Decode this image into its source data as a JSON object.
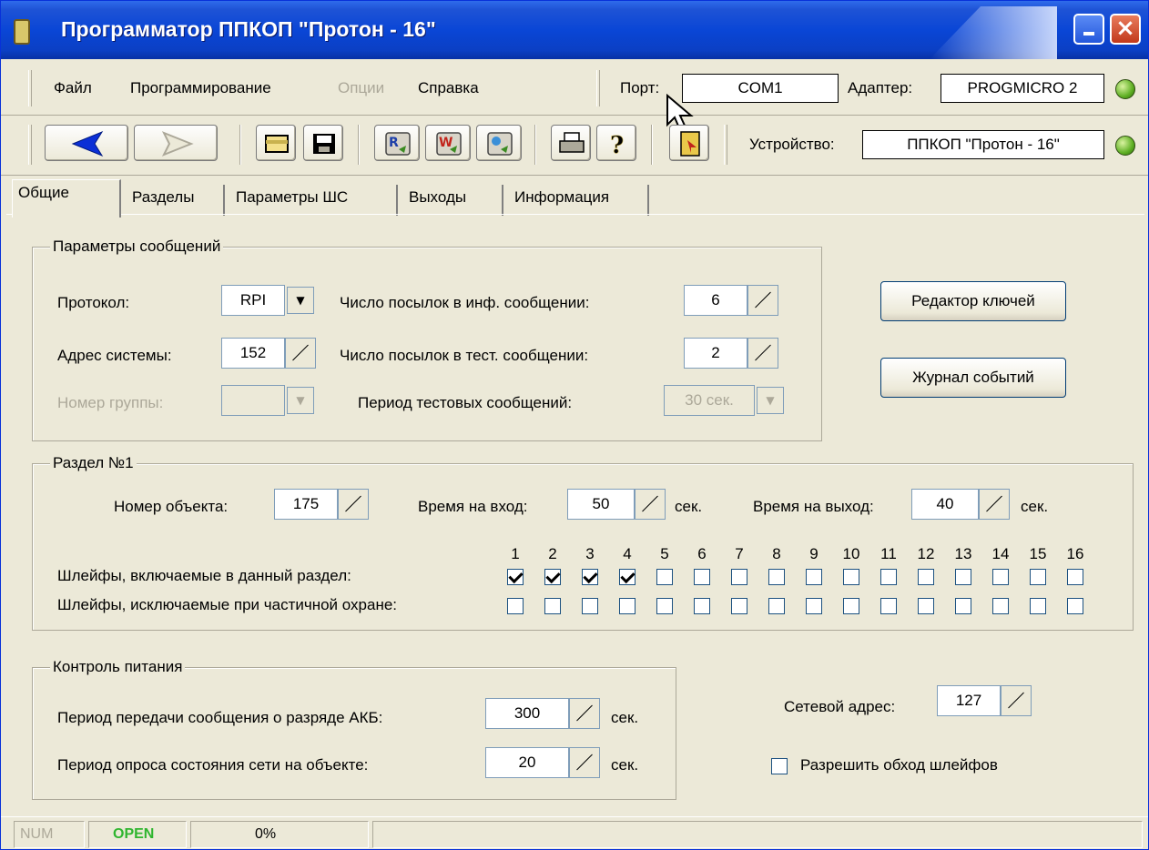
{
  "window": {
    "title": "Программатор ППКОП \"Протон - 16\""
  },
  "menu": {
    "file": "Файл",
    "programming": "Программирование",
    "options": "Опции",
    "help": "Справка"
  },
  "port": {
    "label": "Порт:",
    "value": "COM1"
  },
  "adapter": {
    "label": "Адаптер:",
    "value": "PROGMICRO 2"
  },
  "device": {
    "label": "Устройство:",
    "value": "ППКОП \"Протон - 16\""
  },
  "toolbar": {
    "icons": [
      "back-icon",
      "forward-icon",
      "open-icon",
      "save-icon",
      "read-icon",
      "write-icon",
      "verify-icon",
      "print-icon",
      "help-icon",
      "exit-icon"
    ]
  },
  "tabs": [
    "Общие",
    "Разделы",
    "Параметры ШС",
    "Выходы",
    "Информация"
  ],
  "messages": {
    "title": "Параметры сообщений",
    "protocol_label": "Протокол:",
    "protocol_value": "RPI",
    "address_label": "Адрес системы:",
    "address_value": "152",
    "group_label": "Номер группы:",
    "group_value": "",
    "inf_count_label": "Число посылок в инф. сообщении:",
    "inf_count_value": "6",
    "test_count_label": "Число посылок в тест. сообщении:",
    "test_count_value": "2",
    "test_period_label": "Период тестовых сообщений:",
    "test_period_value": "30 сек."
  },
  "buttons": {
    "key_editor": "Редактор ключей",
    "event_log": "Журнал событий"
  },
  "section": {
    "title": "Раздел №1",
    "object_label": "Номер объекта:",
    "object_value": "175",
    "entry_label": "Время на вход:",
    "entry_value": "50",
    "entry_unit": "сек.",
    "exit_label": "Время на выход:",
    "exit_value": "40",
    "exit_unit": "сек.",
    "loops": [
      "1",
      "2",
      "3",
      "4",
      "5",
      "6",
      "7",
      "8",
      "9",
      "10",
      "11",
      "12",
      "13",
      "14",
      "15",
      "16"
    ],
    "included_label": "Шлейфы, включаемые в данный раздел:",
    "included": [
      true,
      true,
      true,
      true,
      false,
      false,
      false,
      false,
      false,
      false,
      false,
      false,
      false,
      false,
      false,
      false
    ],
    "excluded_label": "Шлейфы, исключаемые при частичной охране:",
    "excluded": [
      false,
      false,
      false,
      false,
      false,
      false,
      false,
      false,
      false,
      false,
      false,
      false,
      false,
      false,
      false,
      false
    ]
  },
  "power": {
    "title": "Контроль питания",
    "battery_label": "Период передачи сообщения о разряде АКБ:",
    "battery_value": "300",
    "battery_unit": "сек.",
    "network_label": "Период опроса состояния сети на объекте:",
    "network_value": "20",
    "network_unit": "сек."
  },
  "net": {
    "address_label": "Сетевой адрес:",
    "address_value": "127",
    "bypass_label": "Разрешить обход шлейфов",
    "bypass": false
  },
  "statusbar": {
    "num": "NUM",
    "open": "OPEN",
    "progress": "0%"
  },
  "colors": {
    "title_bar": "#0a46d6",
    "face": "#ece9d8",
    "open_status": "#2fb52f",
    "led": "#5fb024"
  }
}
